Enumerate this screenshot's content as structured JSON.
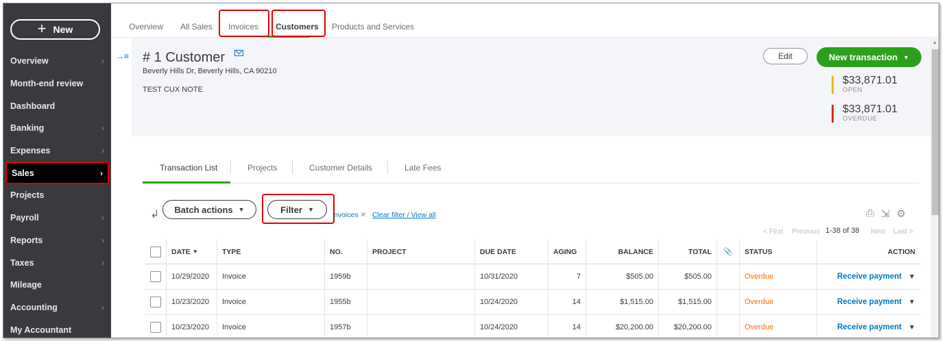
{
  "sidebar": {
    "new_label": "New",
    "items": [
      {
        "label": "Overview",
        "chevron": true
      },
      {
        "label": "Month-end review",
        "chevron": false
      },
      {
        "label": "Dashboard",
        "chevron": false
      },
      {
        "label": "Banking",
        "chevron": true
      },
      {
        "label": "Expenses",
        "chevron": true
      },
      {
        "label": "Sales",
        "chevron": true,
        "active": true
      },
      {
        "label": "Projects",
        "chevron": false
      },
      {
        "label": "Payroll",
        "chevron": true
      },
      {
        "label": "Reports",
        "chevron": true
      },
      {
        "label": "Taxes",
        "chevron": true
      },
      {
        "label": "Mileage",
        "chevron": false
      },
      {
        "label": "Accounting",
        "chevron": true
      },
      {
        "label": "My Accountant",
        "chevron": false
      }
    ]
  },
  "top_tabs": [
    {
      "label": "Overview"
    },
    {
      "label": "All Sales"
    },
    {
      "label": "Invoices"
    },
    {
      "label": "Customers",
      "active": true
    },
    {
      "label": "Products and Services"
    }
  ],
  "customer": {
    "name": "# 1 Customer",
    "address": "Beverly Hills Dr, Beverly Hills, CA 90210",
    "note": "TEST CUX NOTE"
  },
  "actions": {
    "edit_label": "Edit",
    "new_transaction_label": "New transaction"
  },
  "stats": {
    "open_amount": "$33,871.01",
    "open_label": "OPEN",
    "overdue_amount": "$33,871.01",
    "overdue_label": "OVERDUE"
  },
  "colors": {
    "accent_green": "#2ca01c",
    "open_bar": "#f0b41c",
    "overdue_bar": "#d52b1e",
    "link_blue": "#0077c5",
    "overdue_text": "#ff6a00",
    "highlight_red": "#e00000"
  },
  "sub_tabs": [
    {
      "label": "Transaction List",
      "active": true
    },
    {
      "label": "Projects"
    },
    {
      "label": "Customer Details"
    },
    {
      "label": "Late Fees"
    }
  ],
  "toolbar": {
    "batch_actions_label": "Batch actions",
    "filter_label": "Filter",
    "filter_chip": "nvoices",
    "clear_filter_label": "Clear filter / View all",
    "icons": [
      "print-icon",
      "export-icon",
      "settings-icon"
    ]
  },
  "pager": {
    "first": "< First",
    "previous": "Previous",
    "count": "1-38 of 38",
    "next": "Next",
    "last": "Last >"
  },
  "table": {
    "columns": [
      "DATE",
      "TYPE",
      "NO.",
      "PROJECT",
      "DUE DATE",
      "AGING",
      "BALANCE",
      "TOTAL",
      "",
      "STATUS",
      "ACTION"
    ],
    "rows": [
      {
        "date": "10/29/2020",
        "type": "Invoice",
        "no": "1959b",
        "project": "",
        "due_date": "10/31/2020",
        "aging": "7",
        "balance": "$505.00",
        "total": "$505.00",
        "status": "Overdue",
        "action": "Receive payment"
      },
      {
        "date": "10/23/2020",
        "type": "Invoice",
        "no": "1955b",
        "project": "",
        "due_date": "10/24/2020",
        "aging": "14",
        "balance": "$1,515.00",
        "total": "$1,515.00",
        "status": "Overdue",
        "action": "Receive payment"
      },
      {
        "date": "10/23/2020",
        "type": "Invoice",
        "no": "1957b",
        "project": "",
        "due_date": "10/24/2020",
        "aging": "14",
        "balance": "$20,200.00",
        "total": "$20,200.00",
        "status": "Overdue",
        "action": "Receive payment"
      }
    ]
  }
}
